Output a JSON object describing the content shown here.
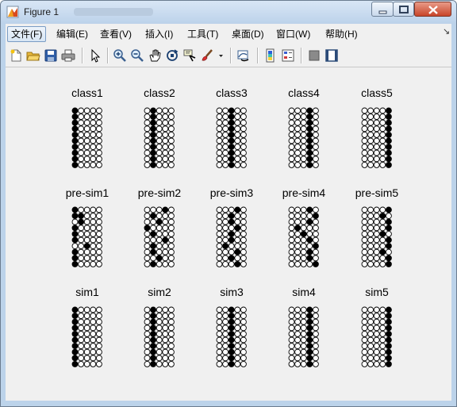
{
  "window": {
    "title": "Figure 1"
  },
  "menu": {
    "items": [
      "文件(F)",
      "编辑(E)",
      "查看(V)",
      "插入(I)",
      "工具(T)",
      "桌面(D)",
      "窗口(W)",
      "帮助(H)"
    ],
    "more": "↘"
  },
  "toolbar": {
    "icons": [
      "new-figure-icon",
      "open-file-icon",
      "save-icon",
      "print-icon",
      "edit-plot-arrow-icon",
      "zoom-in-icon",
      "zoom-out-icon",
      "pan-hand-icon",
      "rotate-3d-icon",
      "data-cursor-icon",
      "brush-icon",
      "brush-dropdown-icon",
      "link-plot-icon",
      "insert-colorbar-icon",
      "insert-legend-icon",
      "hide-plot-tools-icon",
      "show-plot-tools-icon"
    ]
  },
  "colors": {
    "filled": "#000000",
    "empty": "#ffffff",
    "canvas": "#f0f0f0"
  },
  "figure": {
    "rows": 5,
    "cols": 5,
    "panels": [
      {
        "title": "class1",
        "filled": [
          [
            0,
            0
          ],
          [
            1,
            0
          ],
          [
            2,
            0
          ],
          [
            3,
            0
          ],
          [
            4,
            0
          ],
          [
            5,
            0
          ],
          [
            6,
            0
          ],
          [
            7,
            0
          ],
          [
            8,
            0
          ],
          [
            9,
            0
          ]
        ]
      },
      {
        "title": "class2",
        "filled": [
          [
            0,
            1
          ],
          [
            1,
            1
          ],
          [
            2,
            1
          ],
          [
            3,
            1
          ],
          [
            4,
            1
          ],
          [
            5,
            1
          ],
          [
            6,
            1
          ],
          [
            7,
            1
          ],
          [
            8,
            1
          ],
          [
            9,
            1
          ]
        ]
      },
      {
        "title": "class3",
        "filled": [
          [
            0,
            2
          ],
          [
            1,
            2
          ],
          [
            2,
            2
          ],
          [
            3,
            2
          ],
          [
            4,
            2
          ],
          [
            5,
            2
          ],
          [
            6,
            2
          ],
          [
            7,
            2
          ],
          [
            8,
            2
          ],
          [
            9,
            2
          ]
        ]
      },
      {
        "title": "class4",
        "filled": [
          [
            0,
            3
          ],
          [
            1,
            3
          ],
          [
            2,
            3
          ],
          [
            3,
            3
          ],
          [
            4,
            3
          ],
          [
            5,
            3
          ],
          [
            6,
            3
          ],
          [
            7,
            3
          ],
          [
            8,
            3
          ],
          [
            9,
            3
          ]
        ]
      },
      {
        "title": "class5",
        "filled": [
          [
            0,
            4
          ],
          [
            1,
            4
          ],
          [
            2,
            4
          ],
          [
            3,
            4
          ],
          [
            4,
            4
          ],
          [
            5,
            4
          ],
          [
            6,
            4
          ],
          [
            7,
            4
          ],
          [
            8,
            4
          ],
          [
            9,
            4
          ]
        ]
      },
      {
        "title": "pre-sim1",
        "filled": [
          [
            0,
            0
          ],
          [
            1,
            0
          ],
          [
            1,
            1
          ],
          [
            2,
            1
          ],
          [
            3,
            0
          ],
          [
            4,
            0
          ],
          [
            5,
            0
          ],
          [
            6,
            2
          ],
          [
            7,
            0
          ],
          [
            8,
            0
          ],
          [
            9,
            0
          ]
        ]
      },
      {
        "title": "pre-sim2",
        "filled": [
          [
            0,
            3
          ],
          [
            1,
            1
          ],
          [
            2,
            2
          ],
          [
            3,
            0
          ],
          [
            4,
            1
          ],
          [
            5,
            3
          ],
          [
            6,
            1
          ],
          [
            7,
            1
          ],
          [
            8,
            2
          ],
          [
            9,
            1
          ]
        ]
      },
      {
        "title": "pre-sim3",
        "filled": [
          [
            0,
            3
          ],
          [
            1,
            2
          ],
          [
            2,
            2
          ],
          [
            3,
            3
          ],
          [
            4,
            2
          ],
          [
            5,
            2
          ],
          [
            6,
            1
          ],
          [
            7,
            3
          ],
          [
            8,
            2
          ],
          [
            9,
            3
          ]
        ]
      },
      {
        "title": "pre-sim4",
        "filled": [
          [
            0,
            3
          ],
          [
            1,
            4
          ],
          [
            2,
            3
          ],
          [
            3,
            1
          ],
          [
            4,
            2
          ],
          [
            5,
            3
          ],
          [
            6,
            4
          ],
          [
            7,
            3
          ],
          [
            8,
            3
          ],
          [
            9,
            4
          ]
        ]
      },
      {
        "title": "pre-sim5",
        "filled": [
          [
            0,
            4
          ],
          [
            1,
            3
          ],
          [
            2,
            4
          ],
          [
            3,
            4
          ],
          [
            4,
            3
          ],
          [
            5,
            4
          ],
          [
            6,
            4
          ],
          [
            7,
            3
          ],
          [
            8,
            4
          ],
          [
            9,
            4
          ]
        ]
      },
      {
        "title": "sim1",
        "filled": [
          [
            0,
            0
          ],
          [
            1,
            0
          ],
          [
            2,
            0
          ],
          [
            3,
            0
          ],
          [
            4,
            0
          ],
          [
            5,
            0
          ],
          [
            6,
            0
          ],
          [
            7,
            0
          ],
          [
            8,
            0
          ],
          [
            9,
            0
          ]
        ]
      },
      {
        "title": "sim2",
        "filled": [
          [
            0,
            1
          ],
          [
            1,
            1
          ],
          [
            2,
            1
          ],
          [
            3,
            1
          ],
          [
            4,
            1
          ],
          [
            5,
            1
          ],
          [
            6,
            1
          ],
          [
            7,
            1
          ],
          [
            8,
            1
          ],
          [
            9,
            1
          ]
        ]
      },
      {
        "title": "sim3",
        "filled": [
          [
            0,
            2
          ],
          [
            1,
            2
          ],
          [
            2,
            2
          ],
          [
            3,
            2
          ],
          [
            4,
            2
          ],
          [
            5,
            2
          ],
          [
            6,
            2
          ],
          [
            7,
            2
          ],
          [
            8,
            2
          ],
          [
            9,
            2
          ]
        ]
      },
      {
        "title": "sim4",
        "filled": [
          [
            0,
            3
          ],
          [
            1,
            3
          ],
          [
            2,
            3
          ],
          [
            3,
            3
          ],
          [
            4,
            3
          ],
          [
            5,
            3
          ],
          [
            6,
            3
          ],
          [
            7,
            3
          ],
          [
            8,
            3
          ],
          [
            9,
            3
          ]
        ]
      },
      {
        "title": "sim5",
        "filled": [
          [
            0,
            4
          ],
          [
            1,
            4
          ],
          [
            2,
            4
          ],
          [
            3,
            4
          ],
          [
            4,
            4
          ],
          [
            5,
            4
          ],
          [
            6,
            4
          ],
          [
            7,
            4
          ],
          [
            8,
            4
          ],
          [
            9,
            4
          ]
        ]
      }
    ]
  }
}
